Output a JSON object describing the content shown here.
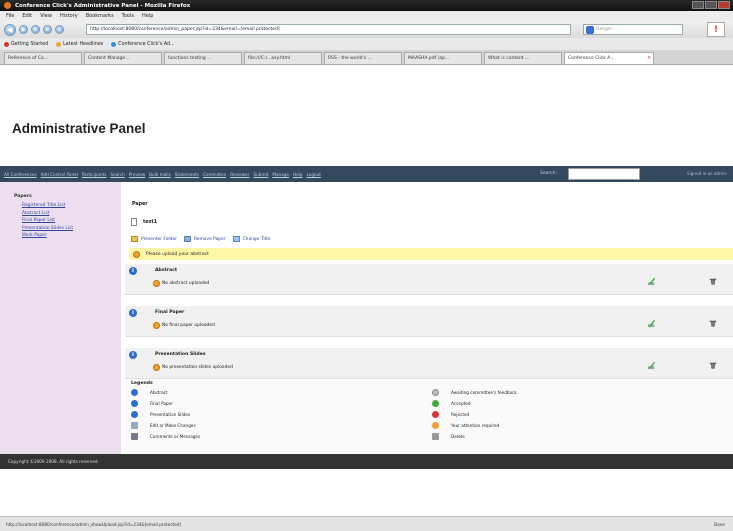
{
  "browser": {
    "window_title": "Conference Click's Administrative Panel - Mozilla Firefox",
    "menu": [
      "File",
      "Edit",
      "View",
      "History",
      "Bookmarks",
      "Tools",
      "Help"
    ],
    "url": "http://localhost:8080/conference/admin_paper.jsp?id=234&email=[email protected]",
    "search_placeholder": "Google",
    "bookmarks": [
      "Getting Started",
      "Latest Headlines",
      "Conference Click's Ad..."
    ],
    "tabs": [
      {
        "label": "Reference of Co..."
      },
      {
        "label": "Content Manage..."
      },
      {
        "label": "functions testing ..."
      },
      {
        "label": "file:///C:/...asy.html"
      },
      {
        "label": "RSS - the world's ..."
      },
      {
        "label": "MAASHA.pdf (ap..."
      },
      {
        "label": "What is content ..."
      },
      {
        "label": "Conference Click A..."
      }
    ],
    "status_url": "http://localhost:8080/conference/admin_showUpload.jsp?id=234&[email protected]",
    "status_done": "Done"
  },
  "page": {
    "title": "Administrative Panel"
  },
  "nav": {
    "links": [
      "All Conferences",
      "Add Control Panel",
      "Participants",
      "Search",
      "Preview",
      "Bulk mails",
      "Statements",
      "Committee",
      "Reviewer",
      "Submit",
      "Manage",
      "Help",
      "Logout"
    ],
    "search_label": "Search:",
    "user_text": "Signed in as admin"
  },
  "sidebar": {
    "heading": "Papers",
    "items": [
      "Registered Title List",
      "Abstract List",
      "Final Paper List",
      "Presentation Slides List",
      "Mark Paper"
    ]
  },
  "main": {
    "paper_heading": "Paper",
    "paper_name": "test1",
    "actions": [
      {
        "label": "Presenter Folder",
        "icon": "folder-icon"
      },
      {
        "label": "Remove Paper",
        "icon": "remove-icon"
      },
      {
        "label": "Change Title",
        "icon": "change-icon"
      }
    ],
    "notice": "Please upload your abstract",
    "sections": [
      {
        "title": "Abstract",
        "status": "No abstract uploaded"
      },
      {
        "title": "Final Paper",
        "status": "No final paper uploaded"
      },
      {
        "title": "Presentation Slides",
        "status": "No presentation slides uploaded"
      }
    ],
    "legend_heading": "Legends",
    "legend_left": [
      {
        "label": "Abstract",
        "icon": "info-icon"
      },
      {
        "label": "Final Paper",
        "icon": "info-icon"
      },
      {
        "label": "Presentation Slides",
        "icon": "info-icon"
      },
      {
        "label": "Edit or Make Changes",
        "icon": "pencil-icon"
      },
      {
        "label": "Comments or Messages",
        "icon": "comment-icon"
      }
    ],
    "legend_right": [
      {
        "label": "Awaiting committee's feedback",
        "icon": "clock-icon"
      },
      {
        "label": "Accepted",
        "icon": "accepted-icon"
      },
      {
        "label": "Rejected",
        "icon": "rejected-icon"
      },
      {
        "label": "Your attention required",
        "icon": "warning-icon"
      },
      {
        "label": "Delete",
        "icon": "trash-icon"
      }
    ]
  },
  "footer": {
    "text": "Copyright ©2009 2008. All rights reserved."
  }
}
